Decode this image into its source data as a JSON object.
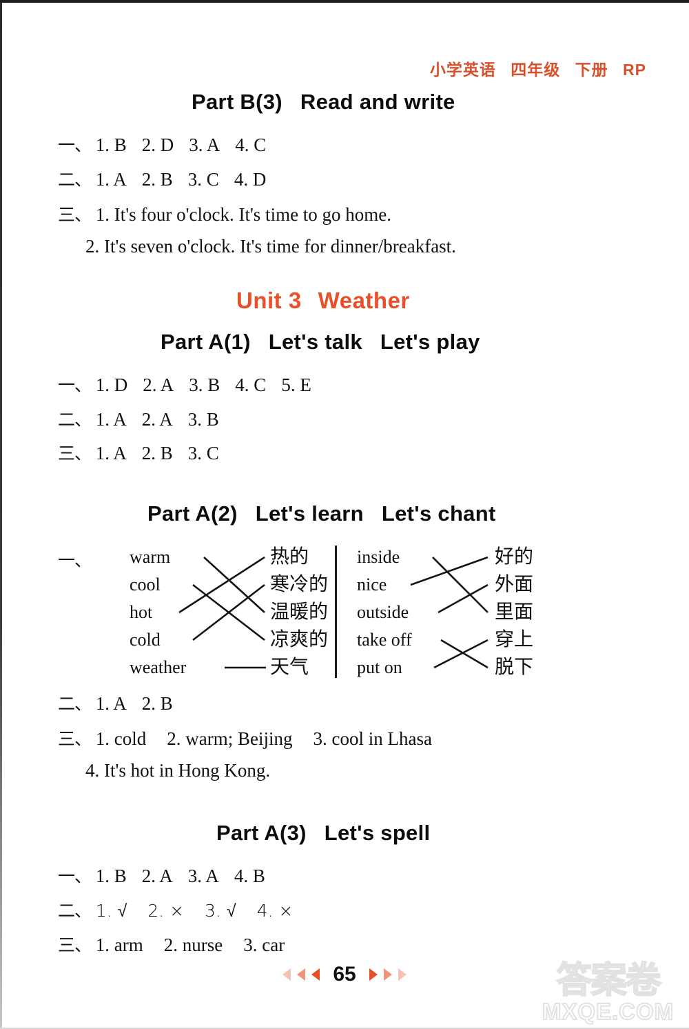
{
  "header": {
    "subject": "小学英语",
    "grade": "四年级",
    "volume": "下册",
    "edition": "RP"
  },
  "sections": [
    {
      "title_part": "Part B(3)",
      "title_rest": "Read and write",
      "rows": [
        {
          "marker": "一、",
          "items": [
            "1. B",
            "2. D",
            "3. A",
            "4. C"
          ]
        },
        {
          "marker": "二、",
          "items": [
            "1. A",
            "2. B",
            "3. C",
            "4. D"
          ]
        },
        {
          "marker": "三、",
          "items": [
            "1. It's four o'clock. It's time to go home."
          ]
        },
        {
          "marker": "",
          "items": [
            "2. It's seven o'clock. It's time for dinner/breakfast."
          ]
        }
      ]
    },
    {
      "title_part": "Part A(1)",
      "title_rest": "Let's talk",
      "title_rest2": "Let's play",
      "rows": [
        {
          "marker": "一、",
          "items": [
            "1. D",
            "2. A",
            "3. B",
            "4. C",
            "5. E"
          ]
        },
        {
          "marker": "二、",
          "items": [
            "1. A",
            "2. A",
            "3. B"
          ]
        },
        {
          "marker": "三、",
          "items": [
            "1. A",
            "2. B",
            "3. C"
          ]
        }
      ]
    },
    {
      "title_part": "Part A(2)",
      "title_rest": "Let's learn",
      "title_rest2": "Let's chant",
      "rows": [
        {
          "marker": "二、",
          "items": [
            "1. A",
            "2. B"
          ]
        },
        {
          "marker": "三、",
          "items": [
            "1. cold",
            "2. warm; Beijing",
            "3. cool in Lhasa"
          ]
        },
        {
          "marker": "",
          "items": [
            "4. It's hot in Hong Kong."
          ]
        }
      ]
    },
    {
      "title_part": "Part A(3)",
      "title_rest": "Let's spell",
      "rows": [
        {
          "marker": "一、",
          "items": [
            "1. B",
            "2. A",
            "3. A",
            "4. B"
          ]
        },
        {
          "marker": "二、",
          "items": [
            "1. √",
            "2. ×",
            "3. √",
            "4. ×"
          ]
        },
        {
          "marker": "三、",
          "items": [
            "1. arm",
            "2. nurse",
            "3. car"
          ]
        }
      ]
    }
  ],
  "unit": {
    "number": "Unit 3",
    "name": "Weather"
  },
  "matching": {
    "marker": "一、",
    "left": {
      "english": [
        "warm",
        "cool",
        "hot",
        "cold",
        "weather"
      ],
      "chinese": [
        "热的",
        "寒冷的",
        "温暖的",
        "凉爽的",
        "天气"
      ],
      "links": [
        [
          0,
          2
        ],
        [
          1,
          3
        ],
        [
          2,
          0
        ],
        [
          3,
          1
        ],
        [
          4,
          4
        ]
      ]
    },
    "right": {
      "english": [
        "inside",
        "nice",
        "outside",
        "take off",
        "put on"
      ],
      "chinese": [
        "好的",
        "外面",
        "里面",
        "穿上",
        "脱下"
      ],
      "links": [
        [
          0,
          2
        ],
        [
          1,
          0
        ],
        [
          2,
          1
        ],
        [
          3,
          4
        ],
        [
          4,
          3
        ]
      ]
    }
  },
  "footer": {
    "page_number": "65"
  },
  "watermark": {
    "cn": "答案卷",
    "en": "MXQE.COM"
  },
  "colors": {
    "accent": "#e8502a",
    "header": "#d9512c",
    "ink": "#111111"
  }
}
